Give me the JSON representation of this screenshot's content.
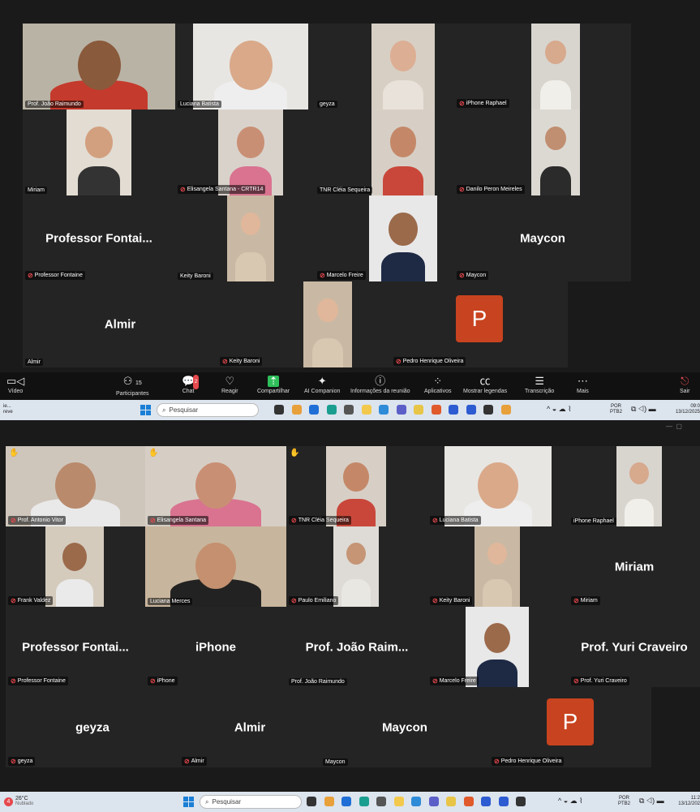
{
  "top": {
    "tiles": [
      {
        "name": "Prof. João Raimundo",
        "muted": false,
        "active": true,
        "bg": "#b9b3a5",
        "skin": "#8a5a3c",
        "shirt": "#c43a2c"
      },
      {
        "name": "Luciana Batista",
        "muted": false,
        "bg": "#e8e6e2",
        "skin": "#d9a98a",
        "shirt": "#eeeeee"
      },
      {
        "name": "geyza",
        "muted": false,
        "bg": "#d8cfc4",
        "skin": "#dcae93",
        "shirt": "#e8e2da"
      },
      {
        "name": "iPhone Raphael",
        "muted": true,
        "bg": "#d8d5cf",
        "skin": "#d7a98d",
        "shirt": "#f1efe9"
      },
      {
        "name": "Miriam",
        "muted": false,
        "bg": "#e2dcd2",
        "skin": "#d2a07f",
        "shirt": "#333333"
      },
      {
        "name": "Elisangela Santana - CRTR14",
        "muted": true,
        "bg": "#d9d2cb",
        "skin": "#c98f74",
        "shirt": "#d97390"
      },
      {
        "name": "TNR Cléia  Sequeira",
        "muted": false,
        "bg": "#d7cfc6",
        "skin": "#c48868",
        "shirt": "#c9473a"
      },
      {
        "name": "Danilo Peron Meireles",
        "muted": true,
        "bg": "#dcd9d3",
        "skin": "#c08e70",
        "shirt": "#2b2b2b"
      },
      {
        "name": "Professor Fontaine",
        "muted": true,
        "big": "Professor  Fontai..."
      },
      {
        "name": "Keity Baroni",
        "muted": false,
        "bg": "#c9b9a4",
        "skin": "#e0b79b",
        "shirt": "#d8c7b1"
      },
      {
        "name": "Marcelo Freire",
        "muted": true,
        "bg": "#e8e8e8",
        "skin": "#9b6a4b",
        "shirt": "#1e2a44"
      },
      {
        "name": "Maycon",
        "muted": true,
        "big": "Maycon"
      },
      {
        "name": "Almir",
        "muted": false,
        "big": "Almir"
      },
      {
        "name": "Keity Baroni",
        "muted": true,
        "bg": "#c9b9a4",
        "skin": "#e0b79b",
        "shirt": "#d8c7b1"
      },
      {
        "name": "Pedro Henrique Oliveira",
        "muted": true,
        "avatar": "P"
      }
    ]
  },
  "toolbar": {
    "video": "Vídeo",
    "participants": "Participantes",
    "participants_count": "15",
    "chat": "Chat",
    "chat_badge": "2",
    "react": "Reagir",
    "share": "Compartilhar",
    "ai": "AI Companion",
    "info": "Informações da reunião",
    "apps": "Aplicativos",
    "captions": "Mostrar legendas",
    "transcript": "Transcrição",
    "more": "Mais",
    "leave": "Sair"
  },
  "taskbar1": {
    "left_line1": "ie...",
    "left_line2": "reve",
    "search": "Pesquisar",
    "lang1": "POR",
    "lang2": "PTB2",
    "time": "09:0",
    "date": "13/12/2025"
  },
  "bottom": {
    "tiles": [
      {
        "name": "Prof. Antonio Vitor",
        "muted": true,
        "hand": true,
        "bg": "#cfc6bb",
        "skin": "#b98a6c",
        "shirt": "#e9e9e9"
      },
      {
        "name": "Elisangela Santana",
        "muted": true,
        "hand": true,
        "bg": "#d6cec5",
        "skin": "#c98f74",
        "shirt": "#d97390"
      },
      {
        "name": "TNR Cléia  Sequeira",
        "muted": true,
        "hand": true,
        "bg": "#d7cfc6",
        "skin": "#c48868",
        "shirt": "#c9473a"
      },
      {
        "name": "Luciana Batista",
        "muted": true,
        "bg": "#e8e6e2",
        "skin": "#d9a98a",
        "shirt": "#eeeeee"
      },
      {
        "name": "iPhone Raphael",
        "muted": false,
        "bg": "#d8d5cf",
        "skin": "#d7a98d",
        "shirt": "#f1efe9"
      },
      {
        "name": "Frank Valdez",
        "muted": true,
        "bg": "#d4cbbd",
        "skin": "#9b6a4b",
        "shirt": "#eaeaea"
      },
      {
        "name": "Luciana Merces",
        "muted": false,
        "active": true,
        "bg": "#c8b59d",
        "skin": "#c4906f",
        "shirt": "#222222"
      },
      {
        "name": "Paulo Emiliano",
        "muted": true,
        "bg": "#dedbd6",
        "skin": "#c59576",
        "shirt": "#e9e7e2"
      },
      {
        "name": "Keity Baroni",
        "muted": true,
        "bg": "#c9b9a4",
        "skin": "#e0b79b",
        "shirt": "#d8c7b1"
      },
      {
        "name": "Miriam",
        "muted": true,
        "big": "Miriam"
      },
      {
        "name": "Professor Fontaine",
        "muted": true,
        "big": "Professor  Fontai..."
      },
      {
        "name": "iPhone",
        "muted": true,
        "big": "iPhone"
      },
      {
        "name": "Prof. João Raimundo",
        "muted": false,
        "big": "Prof. João Raim..."
      },
      {
        "name": "Marcelo Freire",
        "muted": true,
        "bg": "#e8e8e8",
        "skin": "#9b6a4b",
        "shirt": "#1e2a44"
      },
      {
        "name": "Prof. Yuri Craveiro",
        "muted": true,
        "big": "Prof. Yuri Craveiro"
      },
      {
        "name": "geyza",
        "muted": true,
        "big": "geyza"
      },
      {
        "name": "Almir",
        "muted": true,
        "big": "Almir"
      },
      {
        "name": "Maycon",
        "muted": false,
        "big": "Maycon"
      },
      {
        "name": "Pedro Henrique Oliveira",
        "muted": true,
        "avatar": "P"
      }
    ]
  },
  "taskbar2": {
    "weather_temp": "26°C",
    "weather_desc": "Nublado",
    "search": "Pesquisar",
    "lang1": "POR",
    "lang2": "PTB2",
    "time": "11:2",
    "date": "13/12/202"
  },
  "colors": {
    "active_border": "#3fd47a",
    "mute_red": "#e5484d",
    "avatar_orange": "#c8431f",
    "toolbar_bg": "#111111",
    "taskbar_bg": "#dce4ee"
  }
}
